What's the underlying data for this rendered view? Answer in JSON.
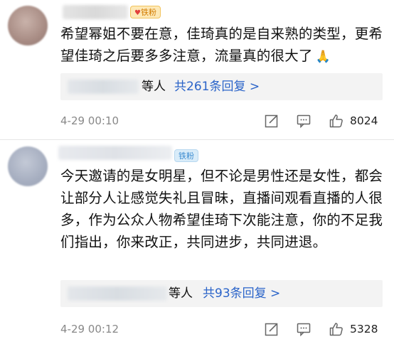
{
  "comments": [
    {
      "badge": "铁粉",
      "text": "希望幂姐不要在意，佳琦真的是自来熟的类型，更希望佳琦之后要多多注意，流量真的很大了",
      "emoji": "🙏",
      "replies": {
        "suffix": "等人",
        "prefix": "共",
        "count": "261",
        "unit": "条回复 >"
      },
      "timestamp": "4-29 00:10",
      "likes": "8024"
    },
    {
      "badge": "铁粉",
      "text": "今天邀请的是女明星，但不论是男性还是女性，都会让部分人让感觉失礼且冒昧，直播间观看直播的人很多，作为公众人物希望佳琦下次能注意，你的不足我们指出，你来改正，共同进步，共同进退。",
      "replies": {
        "suffix": "等人",
        "prefix": "共",
        "count": "93",
        "unit": "条回复 >"
      },
      "timestamp": "4-29 00:12",
      "likes": "5328"
    }
  ],
  "colors": {
    "link": "#2b64c9",
    "badge1_bg": "#fde9b7",
    "badge1_fg": "#d27b00",
    "badge2_bg": "#d9ecf9",
    "badge2_fg": "#3b8bd0"
  },
  "icons": [
    "edit-icon",
    "comment-icon",
    "like-icon"
  ]
}
